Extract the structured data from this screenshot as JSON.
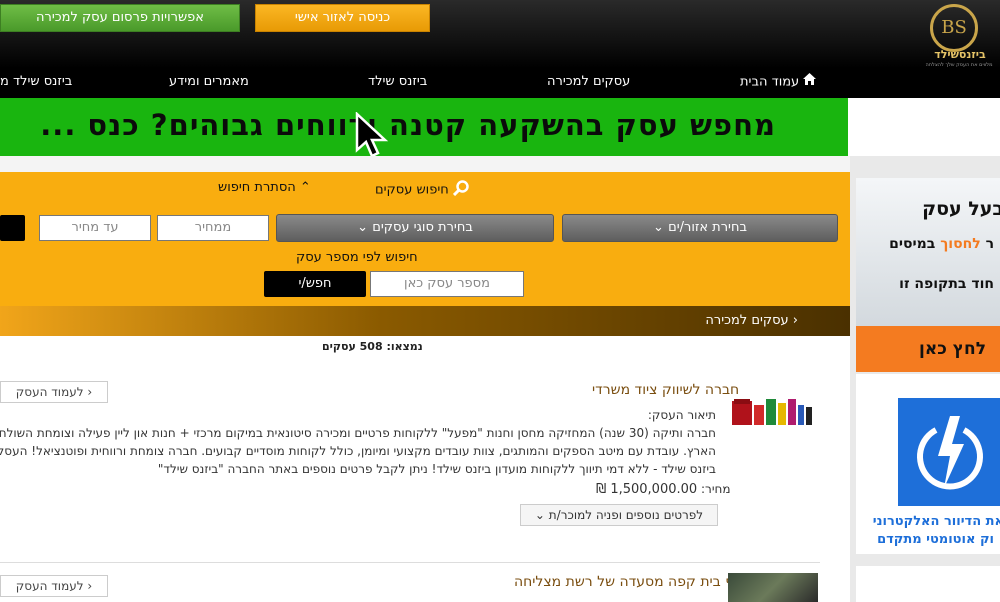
{
  "header": {
    "advertise_button": "אפשרויות פרסום עסק למכירה",
    "login_button": "כניסה לאזור אישי",
    "logo_monogram": "BS",
    "logo_name": "ביזנסשילד",
    "logo_tagline": "מלווים את העסק שלך להצלחה"
  },
  "nav": {
    "home": "עמוד הבית",
    "business_for_sale": "עסקים למכירה",
    "business_shield": "ביזנס שילד",
    "articles": "מאמרים ומידע",
    "business_shield_more": "ביזנס שילד מ"
  },
  "banner": {
    "text": "מחפש עסק בהשקעה קטנה ורווחים גבוהים? כנס ..."
  },
  "search": {
    "search_business": "חיפוש עסקים",
    "hide_search": "הסתרת חיפוש",
    "region_select": "בחירת אזור/ים",
    "type_select": "בחירת סוגי עסקים",
    "price_from_placeholder": "ממחיר",
    "price_to_placeholder": "עד מחיר",
    "by_number_label": "חיפוש לפי מספר עסק",
    "number_placeholder": "מספר עסק כאן",
    "search_button": "חפש/י"
  },
  "breadcrumb": {
    "current": "עסקים למכירה"
  },
  "results": {
    "found_text": "נמצאו: 508 עסקים"
  },
  "listings": [
    {
      "title": "חברה לשיווק ציוד משרדי",
      "desc_label": "תיאור העסק:",
      "desc_lines": [
        "חברה ותיקה (30 שנה) המחזיקה מחסן וחנות \"מפעל\" ללקוחות פרטיים ומכירה סיטונאית במיקום מרכזי + חנות און ליין פעילה וצומחת השולחת הזמנות ללק",
        "הארץ. עובדת עם מיטב הספקים והמותגים, צוות עובדים מקצועי ומיומן, כולל לקוחות מוסדיים קבועים. חברה צומחת ורווחית ופוטנציאל! העסק נמכר בבלעד",
        "ביזנס שילד - ללא דמי תיווך ללקוחות מועדון ביזנס שילד! ניתן לקבל פרטים נוספים באתר החברה \"ביזנס שילד\""
      ],
      "price_label": "מחיר:",
      "price": "1,500,000.00 ₪",
      "more_button": "לפרטים נוספים ופניה למוכר/ת",
      "back_button": "לעמוד העסק"
    },
    {
      "title": "סניף בית קפה מסעדה של רשת מצליחה",
      "back_button": "לעמוד העסק"
    }
  ],
  "ads": {
    "ad1_title": "בעל עסק",
    "ad1_line2_prefix": "ר",
    "ad1_line2_highlight": "לחסוך",
    "ad1_line2_suffix": "במיסים",
    "ad1_line3": "חוד בתקופה זו",
    "ad1_cta": "לחץ כאן",
    "ad2_line1": "את הדיוור האלקטרוני",
    "ad2_line2": "וק אוטומטי מתקדם"
  },
  "colors": {
    "green_banner": "#19b50f",
    "search_panel": "#f9ad0f",
    "accent_orange": "#f47b20",
    "ad_blue": "#1e6fd9"
  }
}
